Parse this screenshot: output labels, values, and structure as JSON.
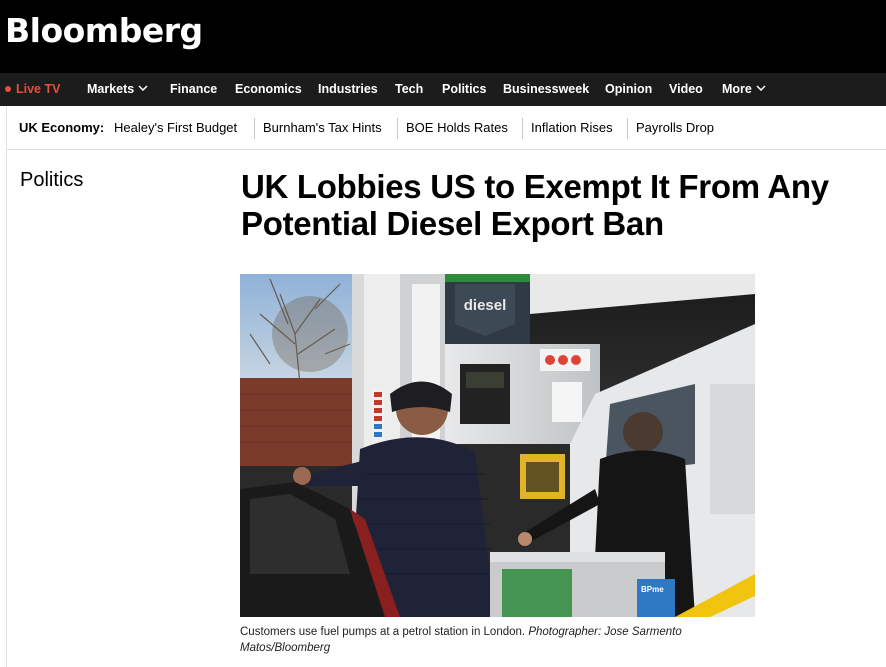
{
  "brand": {
    "logo_text": "Bloomberg"
  },
  "nav": {
    "live_label": "Live TV",
    "items": [
      "Markets",
      "Finance",
      "Economics",
      "Industries",
      "Tech",
      "Politics",
      "Businessweek",
      "Opinion",
      "Video",
      "More"
    ]
  },
  "subnav": {
    "label": "UK Economy:",
    "links": [
      "Healey's First Budget",
      "Burnham's Tax Hints",
      "BOE Holds Rates",
      "Inflation Rises",
      "Payrolls Drop"
    ]
  },
  "article": {
    "section": "Politics",
    "headline_line1": "UK Lobbies US to Exempt It From Any",
    "headline_line2": "Potential Diesel Export Ban",
    "image_sign_text": "diesel",
    "image_sticker_text": "BPme",
    "caption_text": "Customers use fuel pumps at a petrol station in London.",
    "caption_credit": "Photographer: Jose Sarmento Matos/Bloomberg"
  },
  "colors": {
    "live_red": "#e94e3c",
    "header_bg": "#000000",
    "nav_bg": "#1c1c1c",
    "bp_green": "#2e8b3c"
  }
}
